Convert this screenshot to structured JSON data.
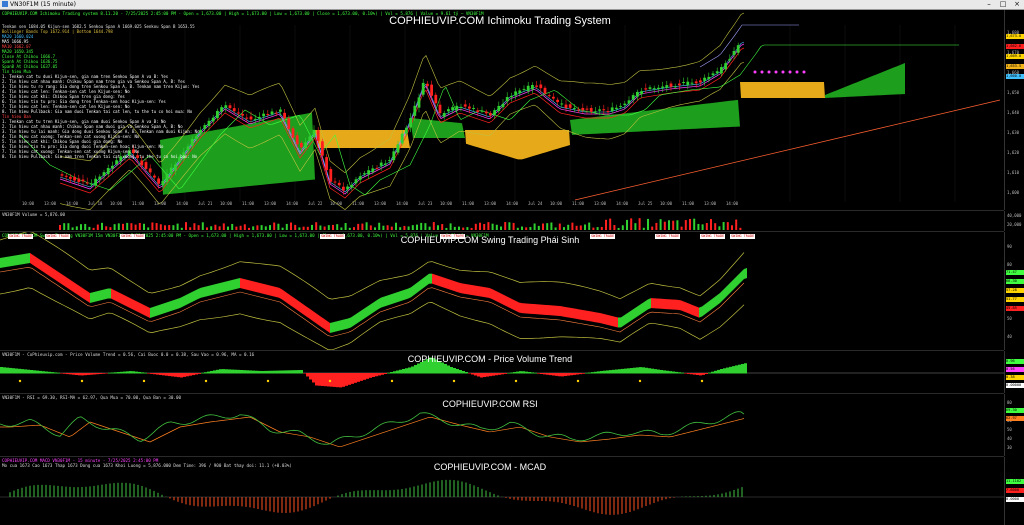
{
  "window": {
    "title": "VN30F1M (15 minute)",
    "min_label": "–",
    "max_label": "□",
    "close_label": "×"
  },
  "colors": {
    "bull": "#2fd02f",
    "bear": "#ff2020",
    "cloud_green": "#1fa81f",
    "cloud_orange": "#f2b21a",
    "background": "#000000",
    "magenta": "#ff40ff",
    "price_tag": "#ffd400"
  },
  "main": {
    "title": "COPHIEUVIP.COM Ichimoku Trading System",
    "header": "COPHIEUVIP.COM Ichimoku Trading system 8.11.20 - 7/25/2025 2:45:00 PM - Open = 1,673.00 | High = 1,673.00 | Low = 1,673.00 | Close = 1,673.00, 0.10%) | Vol = 5,876 | Value =  9.61 tỷ  —  VN30F1M",
    "legend": [
      {
        "text": "Tenkan sen 1684.05   Kijun-sen 1682.5   Senkou Span A 1669.025   Senkou Span B 1653.55",
        "color": "#e8e8e8"
      },
      {
        "text": "Bollinger Bands Top 1672.914 | Bottom 1644.798",
        "color": "#e0c040"
      },
      {
        "text": "MA20 1660.024",
        "color": "#40c0ff"
      },
      {
        "text": "MA5 1666.95",
        "color": "#ffffff"
      },
      {
        "text": "MA10 1662.07",
        "color": "#ff4040"
      },
      {
        "text": "MA20 1650.345",
        "color": "#40ff40"
      },
      {
        "text": "Close At Chikou 1666.7",
        "color": "#40ff40"
      },
      {
        "text": "Spanh At Chikou 1636.75",
        "color": "#40ff40"
      },
      {
        "text": "SpanB At Chikou 1637.05",
        "color": "#40ff40"
      },
      {
        "text": "Tin hieu Mua",
        "color": "#40ff40"
      },
      {
        "text": "1. Tenkan cat tu duoi Kijun-sen, gia nam tren Senkou Span A va B: Yes",
        "color": "#ffffff"
      },
      {
        "text": "2. Tin hieu cat nhau manh: Chikou Span nam tren gia va Senkou Span A, B: Yes",
        "color": "#ffffff"
      },
      {
        "text": "3. Tin hieu tu ro rang: Gia dong tren Senkou Span A, B. Tenkan nam tren Kijun: Yes",
        "color": "#ffffff"
      },
      {
        "text": "4. Tin hieu cat len: Tenkan-sen cat len Kijun-sen: No",
        "color": "#ffffff"
      },
      {
        "text": "5. Tin hieu cat khi: Chikou Span tren gia dong: Yes",
        "color": "#ffffff"
      },
      {
        "text": "6. Tin hieu tin tu pro: Gia dong tren Tenkan-sen hoac Kijun-sen: Yes",
        "color": "#ffffff"
      },
      {
        "text": "7. Tin hieu cat len: Tenkan-sen cat len Kijun-sen: No",
        "color": "#ffffff"
      },
      {
        "text": "8. Tin hieu Pullback: Gia nam duoi Tenkan tai cat len, tu the tu co hoi mua: No",
        "color": "#ffffff"
      },
      {
        "text": "Tin hieu Ban",
        "color": "#ff4040"
      },
      {
        "text": "1. Tenkan cat tu tren Kijun-sen, gia nam duoi Senkou Span A va B: No",
        "color": "#ffffff"
      },
      {
        "text": "2. Tin hieu cat nhau manh: Chikou Span nam duoi gia va Senkou Span A, B: No",
        "color": "#ffffff"
      },
      {
        "text": "3. Tin hieu tu lai manh: Gia dong duoi Senkou Span A, B. Tenkan nam duoi Kijun: No",
        "color": "#ffffff"
      },
      {
        "text": "4. Tin hieu cat xuong: Tenkan-sen cat xuong Kijun-sen: No",
        "color": "#ffffff"
      },
      {
        "text": "5. Tin hieu cat khi: Chikou Span duoi gia dong: No",
        "color": "#ffffff"
      },
      {
        "text": "6. Tin hieu tin tu pro: Gia dong duoi Tenkan-sen hoac Kijun-sen: No",
        "color": "#ffffff"
      },
      {
        "text": "7. Tin hieu cat xuong: Tenkan-sen cat xuong Kijun-sen: No",
        "color": "#ffffff"
      },
      {
        "text": "8. Tin hieu Pullback: Gia nam tren Tenkan tai cat xuong, tu the tu co hoi ban: No",
        "color": "#ffffff"
      }
    ],
    "axis_ticks": [
      "1,680",
      "1,670",
      "1,660",
      "1,650",
      "1,640",
      "1,630",
      "1,620",
      "1,610",
      "1,600"
    ],
    "price_tags": [
      {
        "text": "1,673.0",
        "color": "#ffd400"
      },
      {
        "text": "1,662.6",
        "color": "#ff2020"
      },
      {
        "text": "1,669.0",
        "color": "#ffd400"
      },
      {
        "text": "1,653.5",
        "color": "#f2b21a"
      },
      {
        "text": "1,660.0",
        "color": "#40c0ff"
      }
    ],
    "time_ticks": [
      "10:00",
      "13:00",
      "14:00",
      "Jul 18",
      "10:00",
      "11:00",
      "13:00",
      "14:00",
      "Jul 21",
      "10:00",
      "11:00",
      "13:00",
      "14:00",
      "Jul 22",
      "10:00",
      "11:00",
      "13:00",
      "14:00",
      "Jul 23",
      "10:00",
      "11:00",
      "13:00",
      "14:00",
      "Jul 24",
      "10:00",
      "11:00",
      "13:00",
      "14:00",
      "Jul 25",
      "10:00",
      "11:00",
      "13:00",
      "14:00"
    ]
  },
  "volume": {
    "header": "VN30F1M  Volume = 5,876.00",
    "axis_ticks": [
      "40,000",
      "20,000"
    ]
  },
  "swing": {
    "title": "COPHIEUVIP.COM Swing Trading Phái Sinh",
    "header": "COPHIEUVIP.COM Swing Trading VN30F1M 15m  VN30F1M - 7/25/2025 2:45:00 PM - Open = 1,673.00 | High = 1,673.00 | Low = 1,673.00 | Close = 1,673.00, 0.10%) | Vol = 5,876 | Value = 9.61 tỷ — VN30F1M",
    "axis_ticks": [
      "90",
      "80",
      "70",
      "60",
      "50",
      "40"
    ],
    "labels": [
      "SWING TRADE",
      "SWING TRADE",
      "SWING TRADE",
      "SWING TRADE",
      "SWING TRADE",
      "SWING TRADE",
      "SWING TRADE",
      "SWING TRADE",
      "SWING TRADE"
    ],
    "price_tags": [
      {
        "text": "71.47",
        "color": "#40ff40"
      },
      {
        "text": "66.30",
        "color": "#40ff40"
      },
      {
        "text": "57.28",
        "color": "#ffd400"
      },
      {
        "text": "51.77",
        "color": "#ffd400"
      },
      {
        "text": "45.85",
        "color": "#ff2020"
      }
    ]
  },
  "pvt": {
    "title": "COPHIEUVIP.COM - Price Volume Trend",
    "header": "VN30F1M - CoPhieuvip.com - Price Volume Trend = 0.56,  Cai Buoc 0.0 = 0.38,  Sau Vao = 0.96,  MA = 0.16",
    "price_tags": [
      {
        "text": "0.96",
        "color": "#40ff40"
      },
      {
        "text": "0.56",
        "color": "#ff40ff"
      },
      {
        "text": "0.38",
        "color": "#ffd400"
      },
      {
        "text": "0.00000",
        "color": "#ffffff"
      }
    ]
  },
  "rsi": {
    "title": "COPHIEUVIP.COM RSI",
    "header": "VN30F1M - RSI = 69.30,  RSI-MA = 62.97,  Qua Mua = 70.00,  Qua Ban = 30.00",
    "axis_ticks": [
      "80",
      "70",
      "60",
      "50",
      "40",
      "30"
    ],
    "price_tags": [
      {
        "text": "69.30",
        "color": "#40ff40"
      },
      {
        "text": "62.97",
        "color": "#ff8020"
      }
    ]
  },
  "macd": {
    "title": "COPHIEUVIP.COM - MCAD",
    "header1": "COPHIEUVIP.COM MACD     VN30F1M  -  15 minute  -  7/25/2025 2:45:00 PM",
    "header2": "Mo cua 1673   Cao 1673   Thap 1673   Dong cua 1673   Khoi Luong = 5,876.000   Dem Time: 396 / 900   Bat thay doi: 11.1 (+0.03%)",
    "price_tags": [
      {
        "text": "11.1162",
        "color": "#40ff40"
      },
      {
        "text": "7.6000",
        "color": "#ff2020"
      },
      {
        "text": "0.0000",
        "color": "#ffffff"
      }
    ]
  }
}
